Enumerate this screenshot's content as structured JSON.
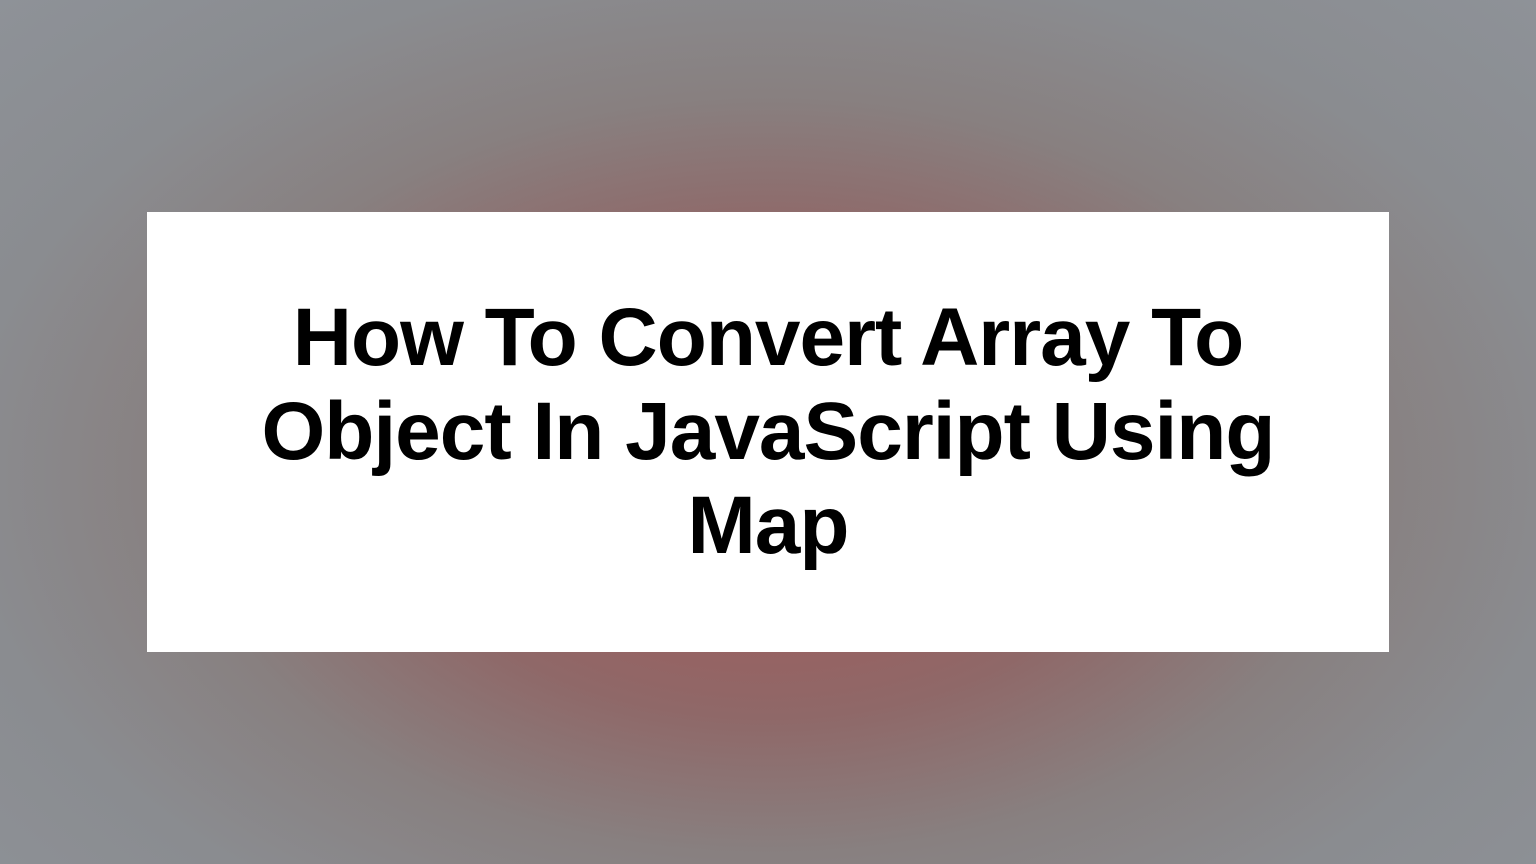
{
  "title": "How To Convert Array To Object In JavaScript Using Map"
}
